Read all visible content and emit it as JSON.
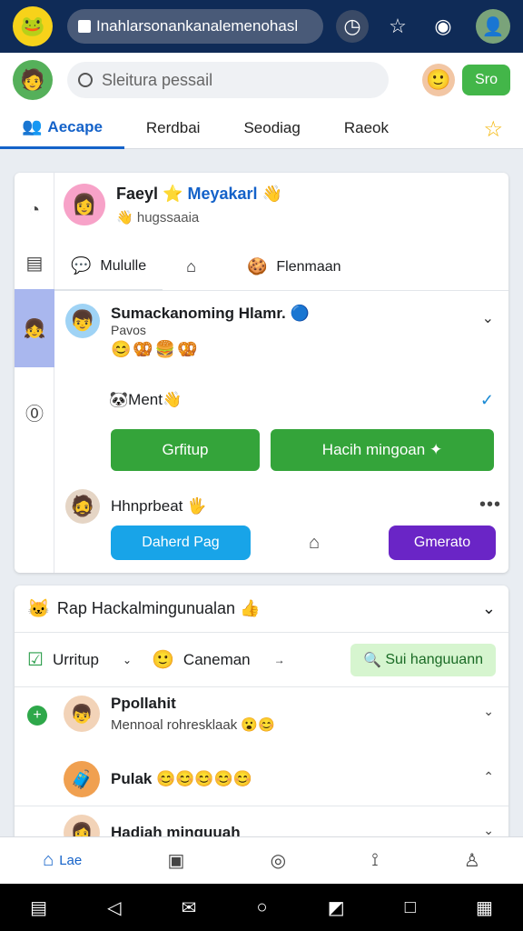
{
  "browser": {
    "url": "Inahlarsonankanalemenohasl",
    "logo_icon": "🐸",
    "icons": [
      "clock-icon",
      "star-icon",
      "chat-icon",
      "profile-icon"
    ]
  },
  "header": {
    "search_placeholder": "Sleitura pessail",
    "action_button": "Sro",
    "tabs": [
      {
        "label": "Aecape",
        "active": true
      },
      {
        "label": "Rerdbai",
        "active": false
      },
      {
        "label": "Seodiag",
        "active": false
      },
      {
        "label": "Raeok",
        "active": false
      }
    ]
  },
  "post": {
    "name_a": "Faeyl",
    "name_b": "Meyakarl",
    "subtitle": "hugssaaia",
    "actions": [
      "Mululle",
      "",
      "Flenmaan"
    ]
  },
  "comment": {
    "title": "Sumackanoming Hlamr.",
    "subtitle": "Pavos",
    "emojis": "😊🥨🍔🥨",
    "ment_label": "Ment",
    "btn_left": "Grfitup",
    "btn_right": "Hacih mingoan"
  },
  "reply": {
    "name": "Hhnprbeat",
    "btn_blue": "Daherd Pag",
    "btn_purple": "Gmerato"
  },
  "card2": {
    "title": "Rap Hackalmingunualan",
    "tool1": "Urritup",
    "tool2": "Caneman",
    "search_btn": "Sui hanguuann",
    "items": [
      {
        "title": "Ppollahit",
        "subtitle": "Mennoal rohresklaak"
      },
      {
        "title": "Pulak",
        "subtitle": ""
      },
      {
        "title": "Hadiah minguuah",
        "subtitle": ""
      }
    ]
  },
  "bottom_nav": {
    "home_label": "Lae"
  }
}
